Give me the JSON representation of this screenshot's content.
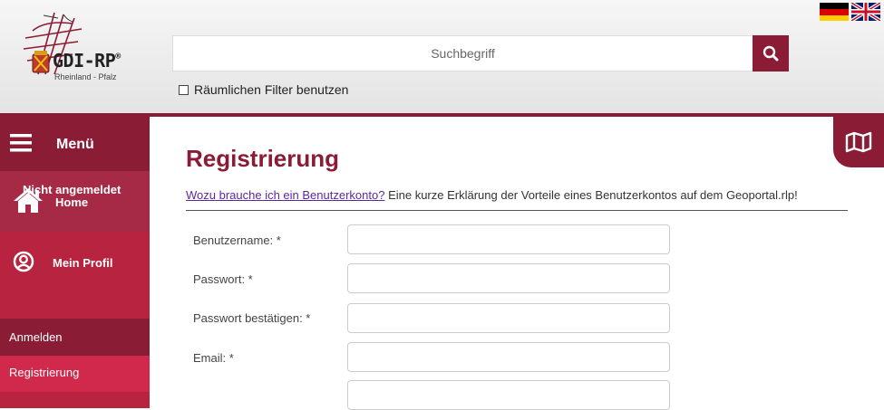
{
  "header": {
    "logo": {
      "brand": "GDI-RP",
      "brand_mark": "®",
      "region": "Rheinland - Pfalz"
    },
    "languages": [
      {
        "name": "de-flag-icon"
      },
      {
        "name": "uk-flag-icon"
      }
    ],
    "search": {
      "placeholder": "Suchbegriff"
    },
    "filter_label": "Räumlichen Filter benutzen"
  },
  "sidebar": {
    "menu_label": "Menü",
    "home_label": "Home",
    "profile_label": "Mein Profil",
    "status": "Nicht angemeldet",
    "login_label": "Anmelden",
    "register_label": "Registrierung"
  },
  "main": {
    "title": "Registrierung",
    "intro_link": "Wozu brauche ich ein Benutzerkonto?",
    "intro_text": " Eine kurze Erklärung der Vorteile eines Benutzerkontos auf dem Geoportal.rlp!",
    "fields": {
      "username": "Benutzername: *",
      "password": "Passwort: *",
      "password_confirm": "Passwort bestätigen: *",
      "email": "Email: *"
    }
  },
  "colors": {
    "brand": "#8a1c35",
    "sidebar_light": "#b8243f",
    "active": "#d0294c"
  }
}
